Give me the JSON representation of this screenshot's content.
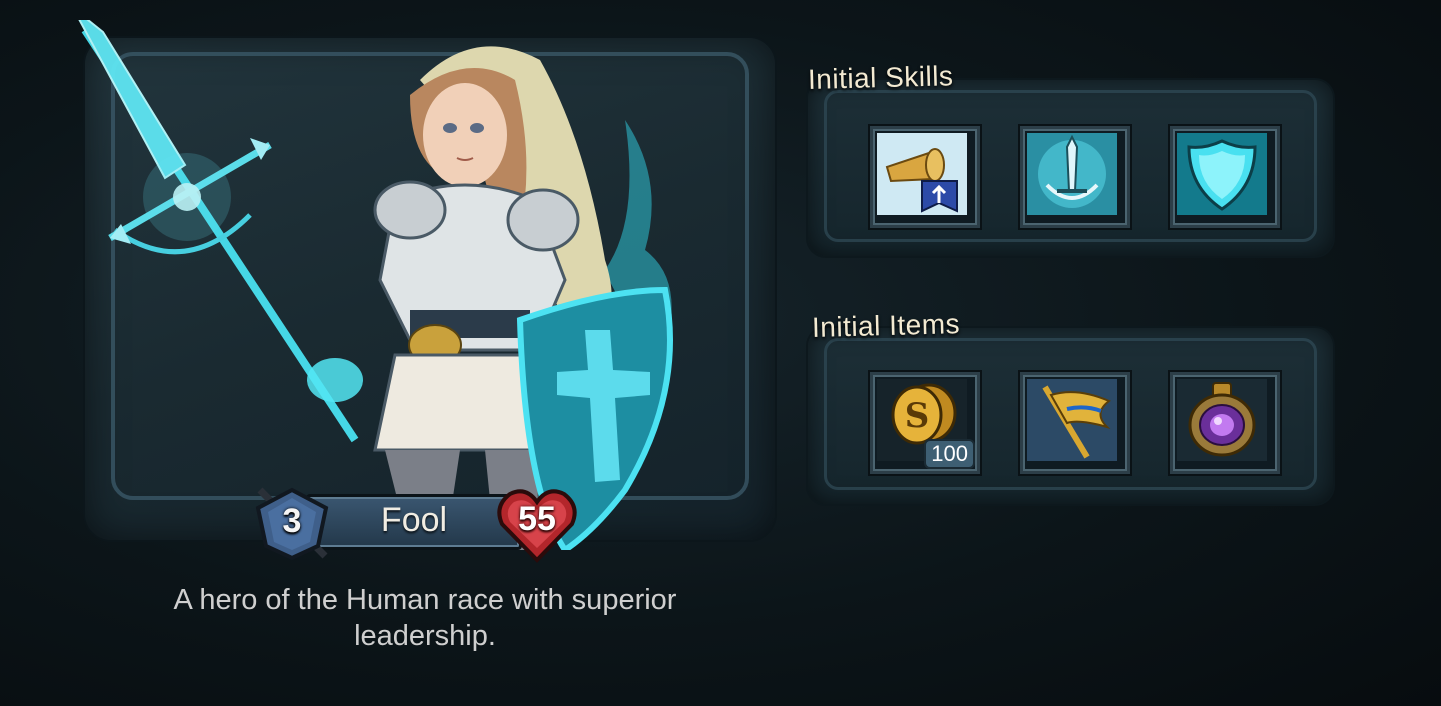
{
  "hero": {
    "name": "Fool",
    "level": "3",
    "hp": "55",
    "description": "A hero of the Human race with superior leadership."
  },
  "skills": {
    "title": "Initial Skills",
    "items": [
      {
        "icon": "horn-banner-icon"
      },
      {
        "icon": "sword-bow-icon"
      },
      {
        "icon": "shield-icon"
      }
    ]
  },
  "items": {
    "title": "Initial Items",
    "items": [
      {
        "icon": "gold-coins-icon",
        "quantity": "100"
      },
      {
        "icon": "golden-flag-icon"
      },
      {
        "icon": "purple-gem-amulet-icon"
      }
    ]
  },
  "colors": {
    "accent_cyan": "#39d3e6",
    "gold": "#d8a730",
    "heart_red": "#b3262b",
    "level_blue": "#3f5f8a"
  }
}
